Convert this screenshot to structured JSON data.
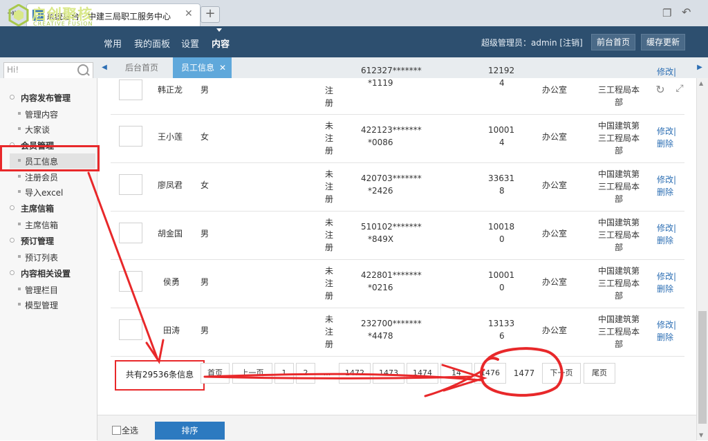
{
  "browser": {
    "tab_title": "系统后台 - 中建三局职工服务中心",
    "tab_close": "✕",
    "new_tab": "+"
  },
  "header": {
    "logo_text": "启创聚核",
    "logo_sub": "CREATIVE FUSION",
    "nav": [
      "常用",
      "我的面板",
      "设置",
      "内容"
    ],
    "active_nav": "内容",
    "admin_label": "超级管理员：admin [注销]",
    "frontpage_btn": "前台首页",
    "cache_btn": "缓存更新"
  },
  "search": {
    "placeholder": "Hi!"
  },
  "page_tabs": {
    "home": "后台首页",
    "employee": "员工信息",
    "close": "✕"
  },
  "sidebar": {
    "groups": [
      {
        "title": "内容发布管理",
        "items": [
          "管理内容",
          "大家谈"
        ]
      },
      {
        "title": "会员管理",
        "items": [
          "员工信息",
          "注册会员",
          "导入excel"
        ]
      },
      {
        "title": "主席信箱",
        "items": [
          "主席信箱"
        ]
      },
      {
        "title": "预订管理",
        "items": [
          "预订列表"
        ]
      },
      {
        "title": "内容相关设置",
        "items": [
          "管理栏目",
          "模型管理"
        ]
      }
    ],
    "active_item": "员工信息"
  },
  "table": {
    "rows": [
      {
        "name": "韩正龙",
        "sex": "男",
        "reg": "注册",
        "id1": "612327*******",
        "id2": "*1119",
        "phone1": "12192",
        "phone2": "4",
        "dept": "办公室",
        "org": "三工程局本部",
        "edit": "修改|",
        "del": ""
      },
      {
        "name": "王小莲",
        "sex": "女",
        "reg": "未注册",
        "id1": "422123*******",
        "id2": "*0086",
        "phone1": "10001",
        "phone2": "4",
        "dept": "办公室",
        "org": "中国建筑第三工程局本部",
        "edit": "修改|",
        "del": "删除"
      },
      {
        "name": "廖凤君",
        "sex": "女",
        "reg": "未注册",
        "id1": "420703*******",
        "id2": "*2426",
        "phone1": "33631",
        "phone2": "8",
        "dept": "办公室",
        "org": "中国建筑第三工程局本部",
        "edit": "修改|",
        "del": "删除"
      },
      {
        "name": "胡金国",
        "sex": "男",
        "reg": "未注册",
        "id1": "510102*******",
        "id2": "*849X",
        "phone1": "10018",
        "phone2": "0",
        "dept": "办公室",
        "org": "中国建筑第三工程局本部",
        "edit": "修改|",
        "del": "删除"
      },
      {
        "name": "侯勇",
        "sex": "男",
        "reg": "未注册",
        "id1": "422801*******",
        "id2": "*0216",
        "phone1": "10001",
        "phone2": "0",
        "dept": "办公室",
        "org": "中国建筑第三工程局本部",
        "edit": "修改|",
        "del": "删除"
      },
      {
        "name": "田涛",
        "sex": "男",
        "reg": "未注册",
        "id1": "232700*******",
        "id2": "*4478",
        "phone1": "13133",
        "phone2": "6",
        "dept": "办公室",
        "org": "中国建筑第三工程局本部",
        "edit": "修改|",
        "del": "删除"
      }
    ]
  },
  "pagination": {
    "total": "共有29536条信息",
    "first": "首页",
    "prev": "上一页",
    "p1": "1",
    "p2": "2",
    "ellipsis": "...",
    "p1472": "1472",
    "p1473": "1473",
    "p1474": "1474",
    "p1475": "14",
    "p1476": "1476",
    "p1477": "1477",
    "next": "下一页",
    "last": "尾页"
  },
  "footer": {
    "select_all": "全选",
    "sort_btn": "排序"
  },
  "colors": {
    "header_bg": "#2d4f6f",
    "accent": "#5fa8db",
    "annotation": "#e8282a",
    "link": "#2d6fb4"
  }
}
